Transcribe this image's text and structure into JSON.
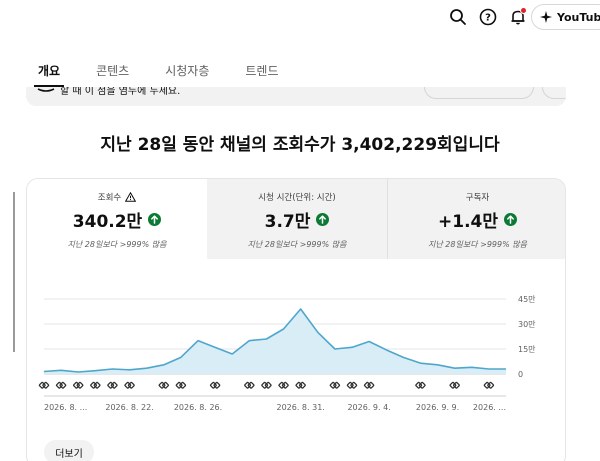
{
  "topbar": {
    "icons": [
      "search-icon",
      "help-icon",
      "notifications-icon",
      "sparkle-icon"
    ],
    "youtube_label": "YouTube"
  },
  "tabs": [
    {
      "label": "개요",
      "active": true
    },
    {
      "label": "콘텐츠",
      "active": false
    },
    {
      "label": "시청자층",
      "active": false
    },
    {
      "label": "트렌드",
      "active": false
    }
  ],
  "banner": {
    "text": "할 때 이 점을 염두에 두세요."
  },
  "headline": "지난 28일 동안 채널의 조회수가 3,402,229회입니다",
  "metrics": [
    {
      "label": "조회수",
      "value": "340.2만",
      "note": "지난 28일보다 >999% 많음",
      "warning": true
    },
    {
      "label": "시청 시간(단위: 시간)",
      "value": "3.7만",
      "note": "지난 28일보다 >999% 많음",
      "warning": false
    },
    {
      "label": "구독자",
      "value": "+1.4만",
      "note": "지난 28일보다 >999% 많음",
      "warning": false
    }
  ],
  "colors": {
    "accent_line": "#4fa6cc",
    "area_fill": "#d9edf7",
    "up_badge": "#0c7a34",
    "grid": "#e6e6e6"
  },
  "chart_data": {
    "type": "area",
    "y_ticks": [
      "45만",
      "30만",
      "15만",
      "0"
    ],
    "ylim": [
      0,
      450000
    ],
    "x_labels": [
      "2026. 8. ...",
      "2026. 8. 22.",
      "2026. 8. 26.",
      "2026. 8. 31.",
      "2026. 9. 4.",
      "2026. 9. 9.",
      "2026. ..."
    ],
    "values": [
      15000,
      22000,
      12000,
      20000,
      30000,
      25000,
      35000,
      55000,
      100000,
      200000,
      160000,
      120000,
      200000,
      210000,
      270000,
      390000,
      250000,
      150000,
      160000,
      195000,
      145000,
      100000,
      65000,
      55000,
      35000,
      40000,
      30000,
      30000
    ],
    "video_markers": [
      0,
      1,
      2,
      3,
      4,
      5,
      7,
      8,
      10,
      12,
      13,
      14,
      15,
      17,
      18,
      19,
      22,
      24,
      26
    ]
  },
  "more_button": "더보기"
}
